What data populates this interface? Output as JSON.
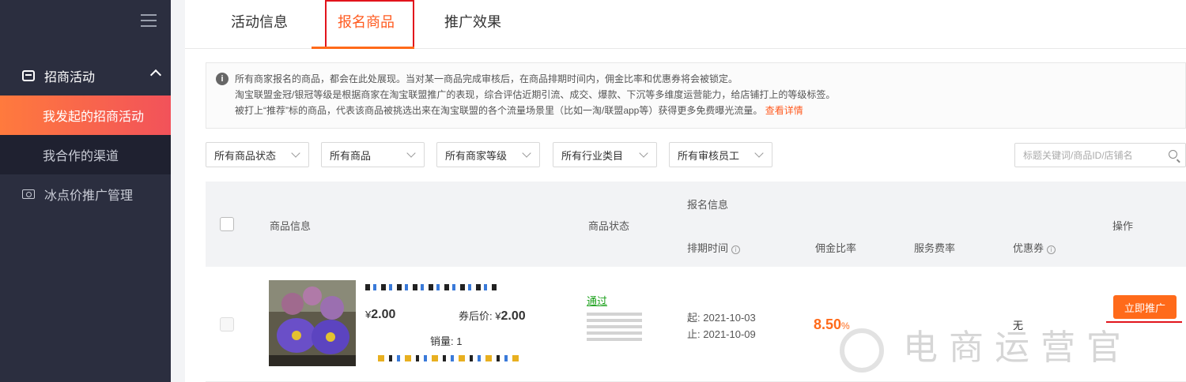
{
  "sidebar": {
    "group1": "招商活动",
    "items": [
      {
        "label": "我发起的招商活动",
        "active": true
      },
      {
        "label": "我合作的渠道",
        "active": false
      }
    ],
    "group2": "冰点价推广管理"
  },
  "tabs": [
    {
      "label": "活动信息"
    },
    {
      "label": "报名商品",
      "active": true
    },
    {
      "label": "推广效果"
    }
  ],
  "notice": {
    "line1": "所有商家报名的商品，都会在此处展现。当对某一商品完成审核后，在商品排期时间内，佣金比率和优惠券将会被锁定。",
    "line2": "淘宝联盟金冠/银冠等级是根据商家在淘宝联盟推广的表现，综合评估近期引流、成交、爆款、下沉等多维度运营能力，给店铺打上的等级标签。",
    "line3": "被打上“推荐”标的商品，代表该商品被挑选出来在淘宝联盟的各个流量场景里（比如一淘/联盟app等）获得更多免费曝光流量。",
    "link": "查看详情"
  },
  "filters": [
    "所有商品状态",
    "所有商品",
    "所有商家等级",
    "所有行业类目",
    "所有审核员工"
  ],
  "search": {
    "placeholder": "标题关键词/商品ID/店铺名"
  },
  "table": {
    "headers": {
      "product_info": "商品信息",
      "status": "商品状态",
      "signup_info": "报名信息",
      "schedule": "排期时间",
      "commission": "佣金比率",
      "service_fee": "服务费率",
      "coupon": "优惠券",
      "action": "操作"
    },
    "rows": [
      {
        "price_symbol": "¥",
        "price": "2.00",
        "after_coupon_label": "券后价:",
        "after_coupon_price": "2.00",
        "sales_label": "销量:",
        "sales": "1",
        "status": "通过",
        "start_label": "起:",
        "start": "2021-10-03",
        "end_label": "止:",
        "end": "2021-10-09",
        "commission": "8.50",
        "commission_unit": "%",
        "coupon": "无",
        "action": "立即推广"
      }
    ]
  },
  "watermark": "电商运营官",
  "colors": {
    "accent": "#ff6a1a",
    "highlight_box": "#e2141c",
    "sidebar_bg": "#2b2e3f"
  }
}
